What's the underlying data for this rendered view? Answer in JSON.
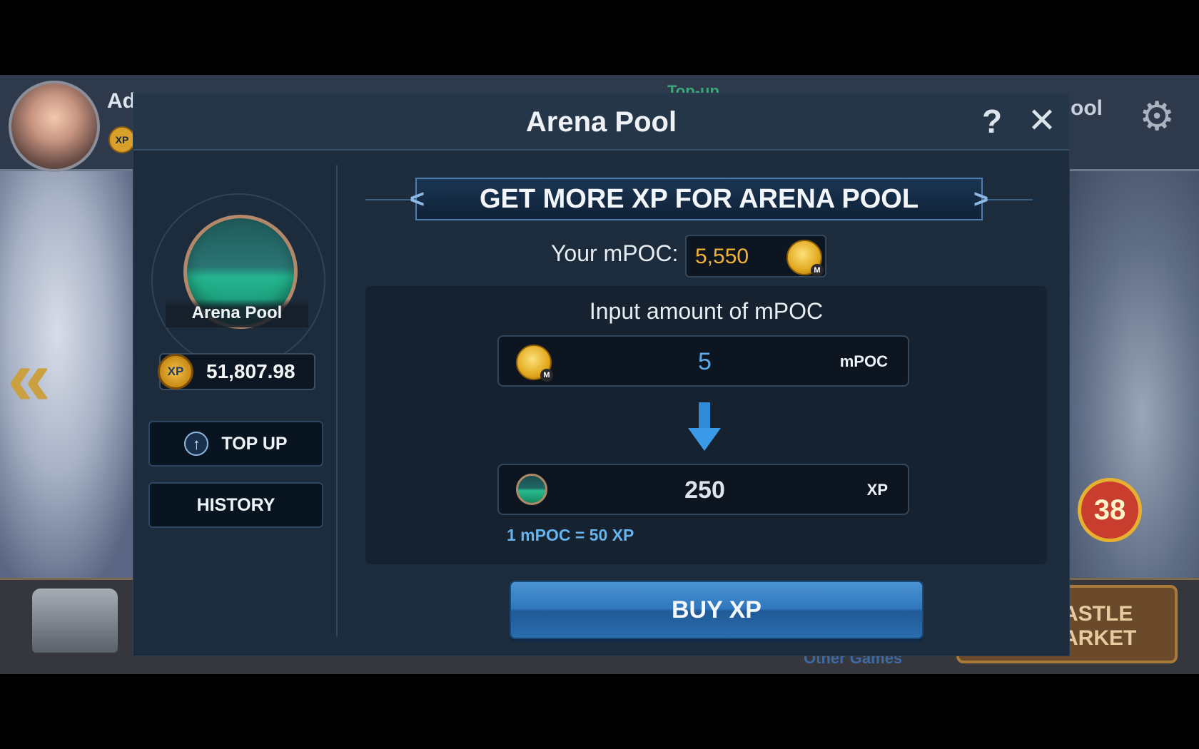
{
  "background": {
    "player_name_partial": "Ad",
    "topup_hint": "Top-up",
    "pool_partial": "ool",
    "level_badge": "38",
    "castle_market": [
      "ASTLE",
      "ARKET"
    ],
    "other_games": "Other Games",
    "xp_mini": "XP"
  },
  "dialog": {
    "title": "Arena Pool",
    "help_label": "?",
    "close_label": "✕"
  },
  "sidebar": {
    "pool_name": "Arena Pool",
    "xp_icon_label": "XP",
    "xp_balance": "51,807.98",
    "topup_label": "TOP UP",
    "history_label": "HISTORY"
  },
  "main": {
    "banner": "GET MORE XP FOR ARENA POOL",
    "your_mpoc_label": "Your mPOC:",
    "your_mpoc_value": "5,550",
    "input_title": "Input amount of mPOC",
    "mpoc_amount": "5",
    "mpoc_unit": "mPOC",
    "xp_amount": "250",
    "xp_unit": "XP",
    "rate": "1 mPOC = 50 XP",
    "buy_label": "BUY XP"
  },
  "colors": {
    "dialog_bg": "#1d2c3d",
    "accent_blue": "#2f76bd",
    "gold": "#f0b43a",
    "rate_blue": "#66b4ee"
  },
  "icons": [
    "gear-icon",
    "back-chevron-icon",
    "help-icon",
    "close-icon",
    "up-arrow-icon",
    "mpoc-coin-icon",
    "xp-coin-icon",
    "arena-orb-icon",
    "down-arrow-icon"
  ]
}
